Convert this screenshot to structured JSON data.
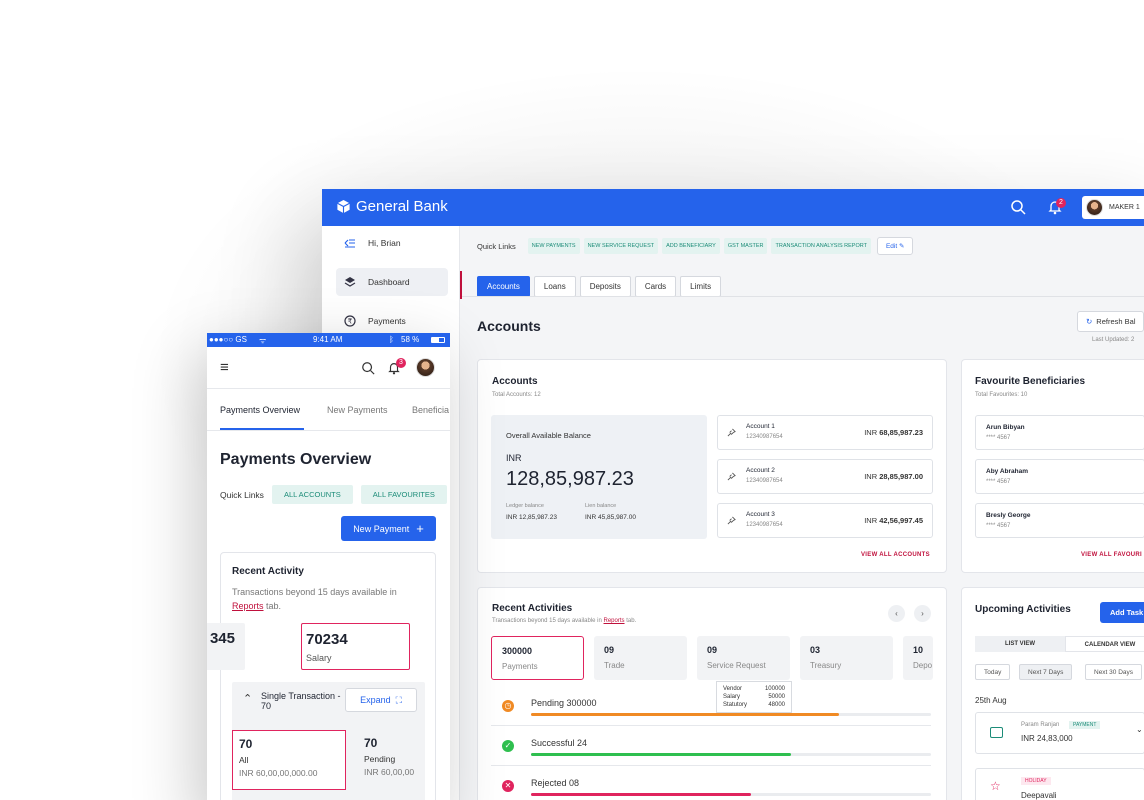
{
  "desktop": {
    "brand": "General Bank",
    "notification_count": "2",
    "user": "MAKER 1",
    "sidebar": {
      "greeting": "Hi, Brian",
      "items": [
        {
          "label": "Dashboard"
        },
        {
          "label": "Payments"
        }
      ]
    },
    "quick_links": {
      "title": "Quick Links",
      "items": [
        "NEW PAYMENTS",
        "NEW SERVICE REQUEST",
        "ADD BENEFICIARY",
        "GST MASTER",
        "TRANSACTION ANALYSIS REPORT"
      ],
      "edit_label": "Edit"
    },
    "tabs": [
      "Accounts",
      "Loans",
      "Deposits",
      "Cards",
      "Limits"
    ],
    "page_title": "Accounts",
    "refresh_label": "Refresh Bal",
    "last_updated": "Last Updated: 2",
    "accounts_card": {
      "title": "Accounts",
      "subtitle": "Total Accounts: 12",
      "overall_label": "Overall Available Balance",
      "currency": "INR",
      "overall_amount": "128,85,987.23",
      "ledger_label": "Ledger balance",
      "ledger_value": "INR 12,85,987.23",
      "lien_label": "Lien balance",
      "lien_value": "INR 45,85,987.00",
      "accounts": [
        {
          "name": "Account 1",
          "number": "12340987654",
          "amount": "68,85,987.23",
          "currency": "INR"
        },
        {
          "name": "Account 2",
          "number": "12340987654",
          "amount": "28,85,987.00",
          "currency": "INR"
        },
        {
          "name": "Account 3",
          "number": "12340987654",
          "amount": "42,56,997.45",
          "currency": "INR"
        }
      ],
      "view_all": "VIEW ALL ACCOUNTS"
    },
    "favourites": {
      "title": "Favourite Beneficiaries",
      "subtitle": "Total Favourites: 10",
      "items": [
        {
          "name": "Arun Bibyan",
          "acct": "**** 4567"
        },
        {
          "name": "Aby Abraham",
          "acct": "**** 4567"
        },
        {
          "name": "Bresly George",
          "acct": "**** 4567"
        }
      ],
      "view_all": "VIEW ALL FAVOURI"
    },
    "recent": {
      "title": "Recent Activities",
      "subtitle_pre": "Transactions beyond 15 days available in ",
      "reports": "Reports",
      "subtitle_post": " tab.",
      "stats": [
        {
          "value": "300000",
          "label": "Payments"
        },
        {
          "value": "09",
          "label": "Trade"
        },
        {
          "value": "09",
          "label": "Service Request"
        },
        {
          "value": "03",
          "label": "Treasury"
        },
        {
          "value": "10",
          "label": "Depo"
        }
      ],
      "tooltip": [
        {
          "k": "Vendor",
          "v": "100000"
        },
        {
          "k": "Salary",
          "v": "50000"
        },
        {
          "k": "Statutory",
          "v": "48000"
        }
      ],
      "rows": [
        {
          "label": "Pending  300000",
          "fraction": 0.77,
          "color": "#f08a24"
        },
        {
          "label": "Successful  24",
          "fraction": 0.65,
          "color": "#2fbf4f"
        },
        {
          "label": "Rejected  08",
          "fraction": 0.55,
          "color": "#e0245e"
        }
      ]
    },
    "upcoming": {
      "title": "Upcoming Activities",
      "add_task": "Add Task",
      "views": [
        "LIST VIEW",
        "CALENDAR VIEW"
      ],
      "ranges": [
        "Today",
        "Next 7 Days",
        "Next 30 Days"
      ],
      "date": "25th Aug",
      "events": [
        {
          "name": "Param Ranjan",
          "tag": "PAYMENT",
          "amount": "INR 24,83,000"
        },
        {
          "tag": "HOLIDAY",
          "name": "Deepavali"
        }
      ]
    }
  },
  "mobile": {
    "carrier": "●●●○○ GS",
    "time": "9:41 AM",
    "battery": "58 %",
    "notification_count": "3",
    "tabs": [
      "Payments Overview",
      "New Payments",
      "Beneficia"
    ],
    "title": "Payments Overview",
    "quick_links_title": "Quick Links",
    "quick_links": [
      "ALL ACCOUNTS",
      "ALL FAVOURITES"
    ],
    "new_payment": "New Payment",
    "recent": {
      "title": "Recent Activity",
      "note_pre": "Transactions beyond 15 days available in ",
      "reports": "Reports",
      "note_post": " tab.",
      "stats": [
        {
          "value": "345",
          "label": ""
        },
        {
          "value": "70234",
          "label": "Salary"
        }
      ],
      "single_label": "Single Transaction - 70",
      "expand": "Expand",
      "cards": [
        {
          "value": "70",
          "label": "All",
          "amount": "INR 60,00,00,000.00"
        },
        {
          "value": "70",
          "label": "Pending",
          "amount": "INR 60,00,00"
        }
      ]
    }
  }
}
